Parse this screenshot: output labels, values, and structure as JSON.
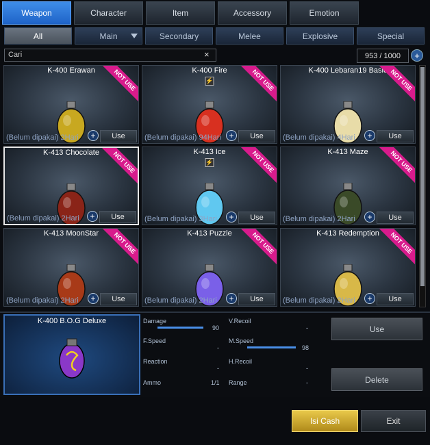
{
  "tabs": [
    "Weapon",
    "Character",
    "Item",
    "Accessory",
    "Emotion"
  ],
  "filters": [
    "All",
    "Main",
    "Secondary",
    "Melee",
    "Explosive",
    "Special"
  ],
  "search": {
    "value": "Cari",
    "clear_glyph": "×"
  },
  "inventory_count": "953 / 1000",
  "count_button_glyph": "+",
  "badge_text": "NOT USE",
  "use_label": "Use",
  "info_glyph": "+",
  "bolt_glyph": "⚡",
  "items": [
    {
      "name": "K-400 Erawan",
      "duration": "(Belum dipakai) 2Hari",
      "bolt": false,
      "color": "#c8a820"
    },
    {
      "name": "K-400 Fire",
      "duration": "(Belum dipakai) 94Hari",
      "bolt": true,
      "color": "#d83020"
    },
    {
      "name": "K-400 Lebaran19 Basic",
      "duration": "(Belum dipakai) 4Hari",
      "bolt": false,
      "color": "#e8dca8"
    },
    {
      "name": "K-413 Chocolate",
      "duration": "(Belum dipakai) 2Hari",
      "bolt": false,
      "color": "#8a2418"
    },
    {
      "name": "K-413 Ice",
      "duration": "(Belum dipakai) 3Hari",
      "bolt": true,
      "color": "#60c8f0"
    },
    {
      "name": "K-413 Maze",
      "duration": "(Belum dipakai) 2Hari",
      "bolt": false,
      "color": "#3a4a28"
    },
    {
      "name": "K-413 MoonStar",
      "duration": "(Belum dipakai) 2Hari",
      "bolt": false,
      "color": "#a83a18"
    },
    {
      "name": "K-413 Puzzle",
      "duration": "(Belum dipakai) 2Hari",
      "bolt": false,
      "color": "#7a60e8"
    },
    {
      "name": "K-413 Redemption",
      "duration": "(Belum dipakai) 2Hari",
      "bolt": false,
      "color": "#d8b848"
    }
  ],
  "selected_index": 3,
  "detail": {
    "name": "K-400 B.O.G Deluxe",
    "color": "#8a38c8",
    "stats": {
      "damage": {
        "label": "Damage",
        "value": "90",
        "level": 0.9
      },
      "fspeed": {
        "label": "F.Speed",
        "value": "-"
      },
      "reaction": {
        "label": "Reaction",
        "value": "-"
      },
      "ammo": {
        "label": "Ammo",
        "value": "1/1"
      },
      "vrecoil": {
        "label": "V.Recoil",
        "value": "-"
      },
      "mspeed": {
        "label": "M.Speed",
        "value": "98",
        "level": 0.98
      },
      "hrecoil": {
        "label": "H.Recoil",
        "value": "-"
      },
      "range": {
        "label": "Range",
        "value": "-"
      }
    },
    "use_label": "Use",
    "delete_label": "Delete"
  },
  "isi_cash_label": "Isi Cash",
  "exit_label": "Exit"
}
